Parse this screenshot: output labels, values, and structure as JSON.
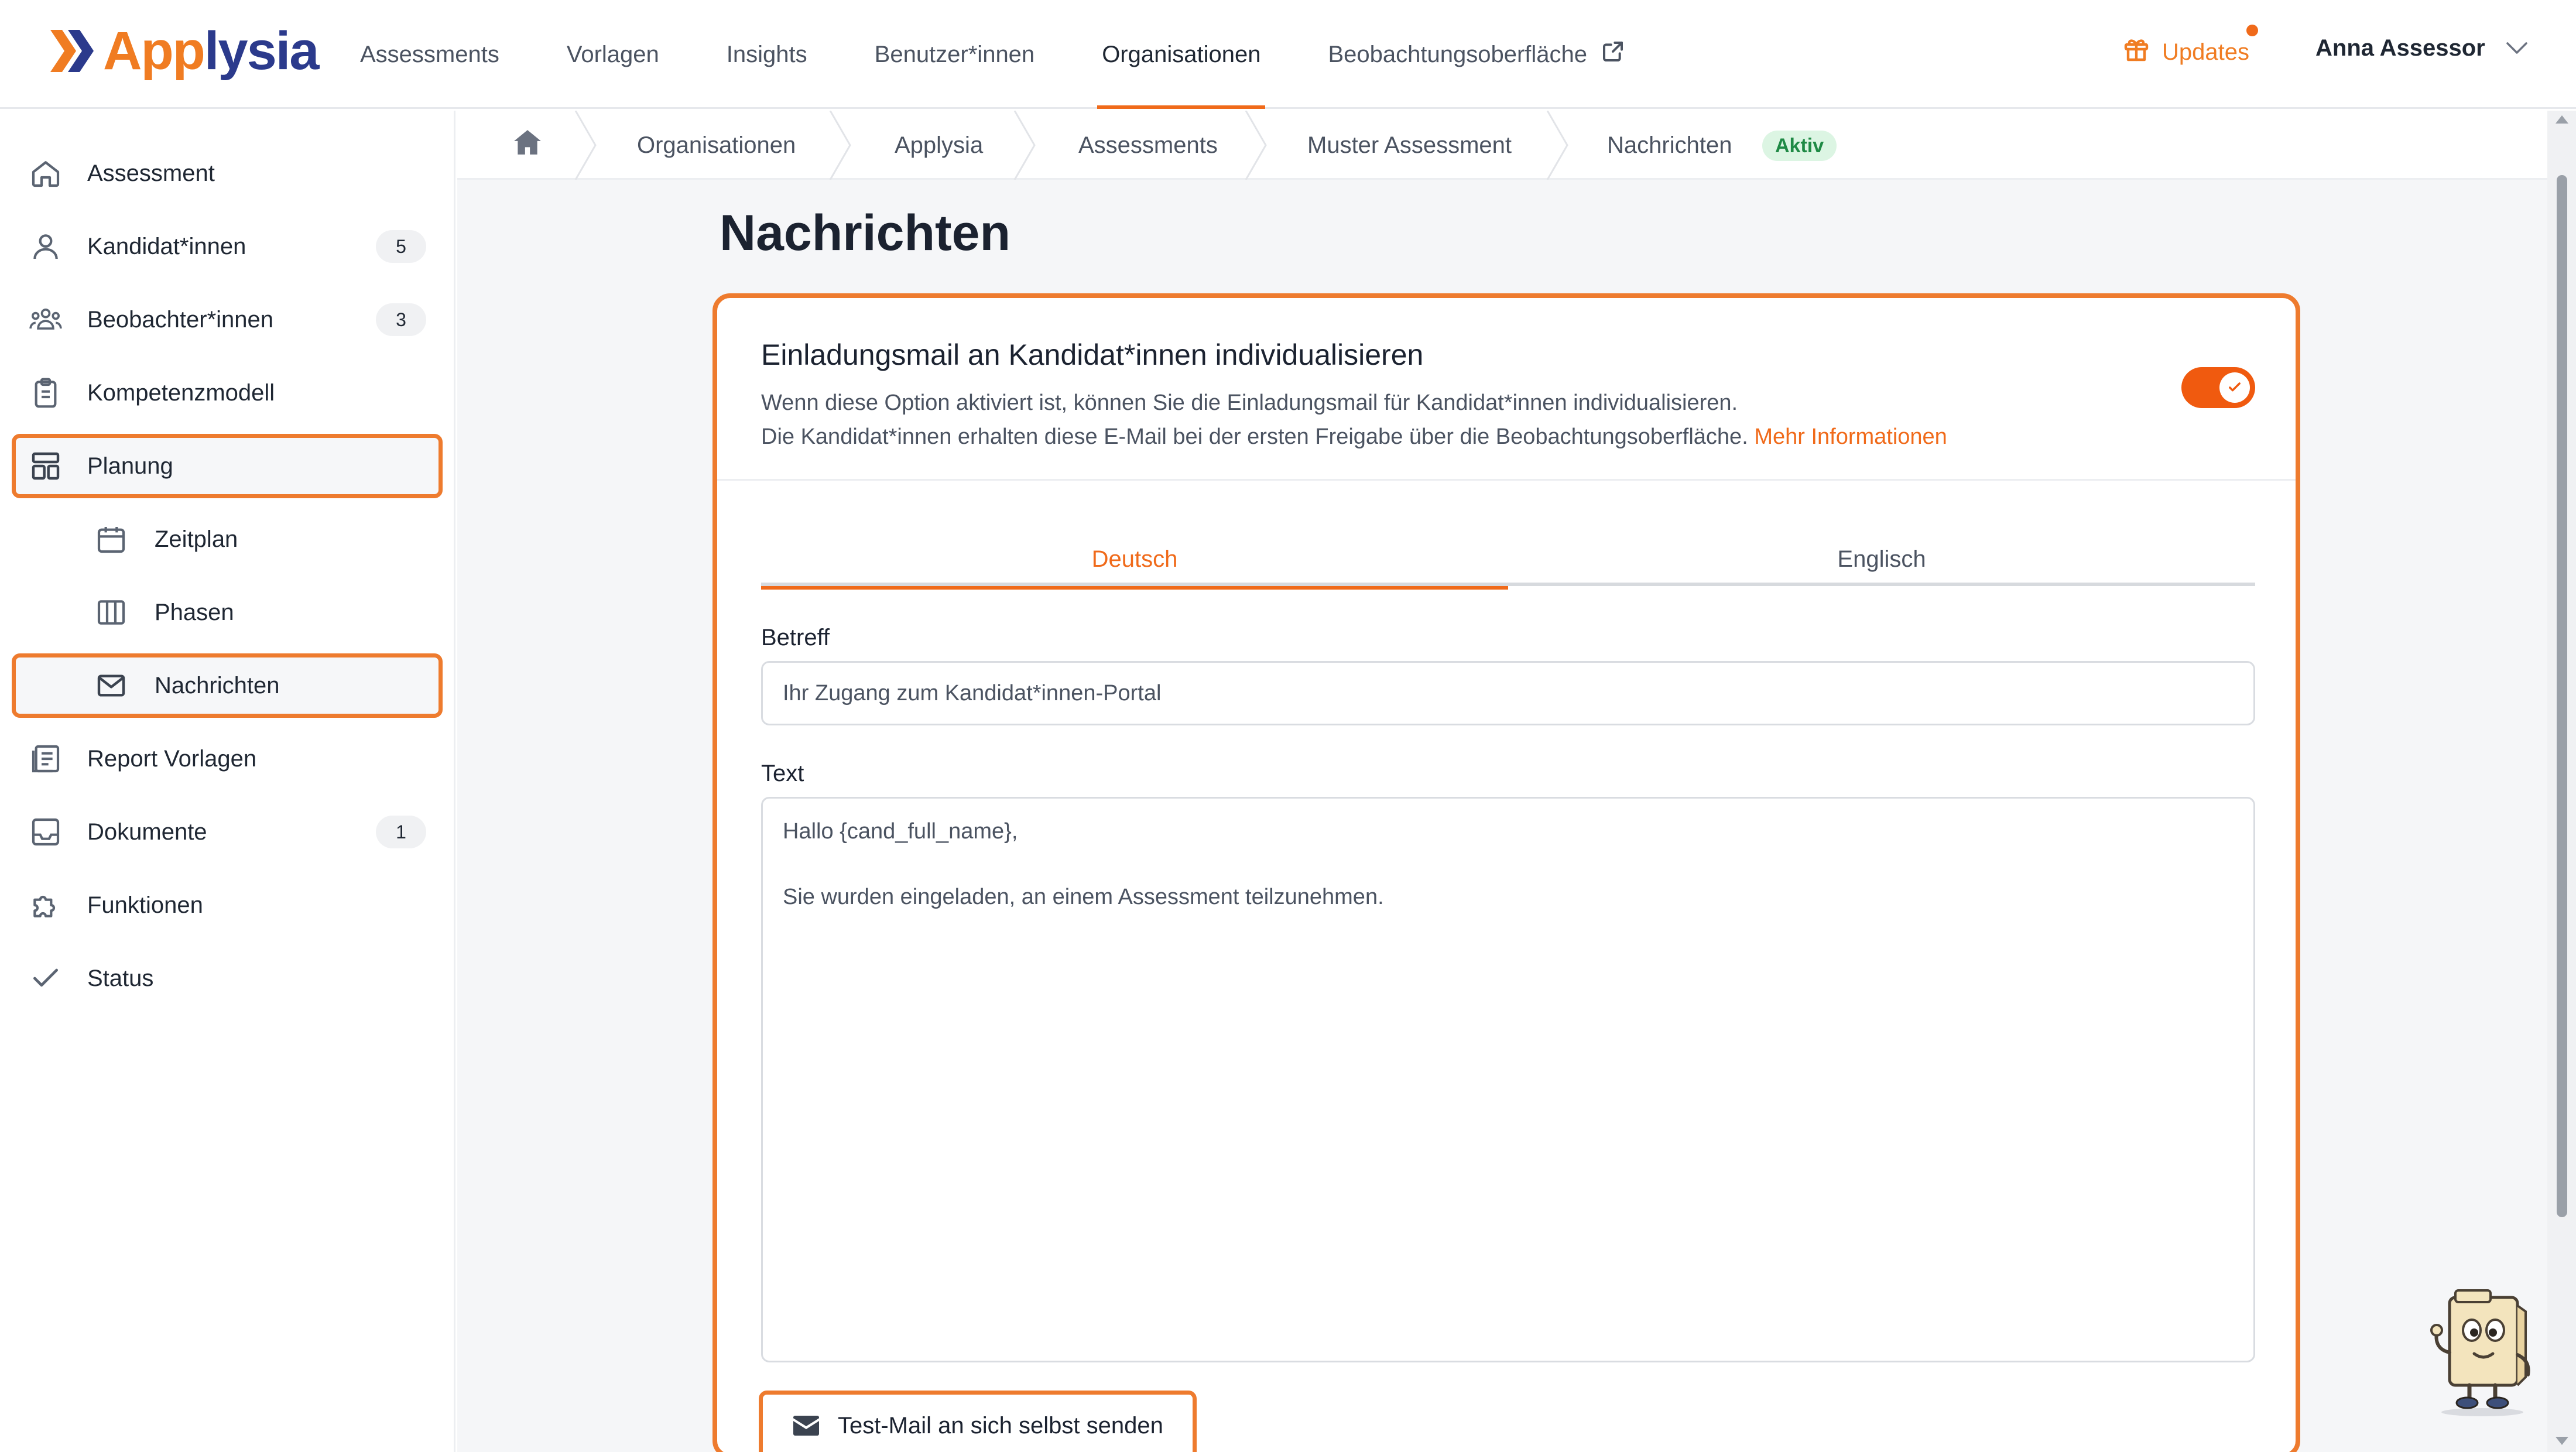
{
  "brand": {
    "logo_text_app": "App",
    "logo_text_lysia": "lysia",
    "accent": "#f06a1a",
    "logo_orange": "#f07c22",
    "logo_blue": "#2b3a8c"
  },
  "topnav": {
    "items": [
      {
        "label": "Assessments"
      },
      {
        "label": "Vorlagen"
      },
      {
        "label": "Insights"
      },
      {
        "label": "Benutzer*innen"
      },
      {
        "label": "Organisationen",
        "active": true
      },
      {
        "label": "Beobachtungsoberfläche",
        "icon": "external-link-icon"
      }
    ],
    "updates_label": "Updates",
    "user_name": "Anna Assessor"
  },
  "sidebar": {
    "items": [
      {
        "label": "Assessment",
        "icon": "home-icon"
      },
      {
        "label": "Kandidat*innen",
        "icon": "users-icon",
        "badge": "5"
      },
      {
        "label": "Beobachter*innen",
        "icon": "group-icon",
        "badge": "3"
      },
      {
        "label": "Kompetenzmodell",
        "icon": "clipboard-icon"
      },
      {
        "label": "Planung",
        "icon": "layout-icon",
        "highlighted": true
      },
      {
        "label": "Zeitplan",
        "icon": "calendar-icon",
        "sub": true
      },
      {
        "label": "Phasen",
        "icon": "columns-icon",
        "sub": true
      },
      {
        "label": "Nachrichten",
        "icon": "mail-icon",
        "sub": true,
        "highlighted": true
      },
      {
        "label": "Report Vorlagen",
        "icon": "report-icon"
      },
      {
        "label": "Dokumente",
        "icon": "inbox-icon",
        "badge": "1"
      },
      {
        "label": "Funktionen",
        "icon": "puzzle-icon"
      },
      {
        "label": "Status",
        "icon": "check-icon"
      }
    ]
  },
  "breadcrumb": {
    "items": [
      "Organisationen",
      "Applysia",
      "Assessments",
      "Muster Assessment",
      "Nachrichten"
    ],
    "status_badge": "Aktiv"
  },
  "page": {
    "title": "Nachrichten",
    "card": {
      "title": "Einladungsmail an Kandidat*innen individualisieren",
      "description_line1": "Wenn diese Option aktiviert ist, können Sie die Einladungsmail für Kandidat*innen individualisieren.",
      "description_line2": "Die Kandidat*innen erhalten diese E-Mail bei der ersten Freigabe über die Beobachtungsoberfläche.",
      "more_info_link": "Mehr Informationen",
      "toggle_on": true,
      "tabs": [
        {
          "label": "Deutsch",
          "active": true
        },
        {
          "label": "Englisch"
        }
      ],
      "subject_label": "Betreff",
      "subject_value": "Ihr Zugang zum Kandidat*innen-Portal",
      "text_label": "Text",
      "text_value": "Hallo {cand_full_name},\n\nSie wurden eingeladen, an einem Assessment teilzunehmen.",
      "test_button_label": "Test-Mail an sich selbst senden"
    }
  }
}
